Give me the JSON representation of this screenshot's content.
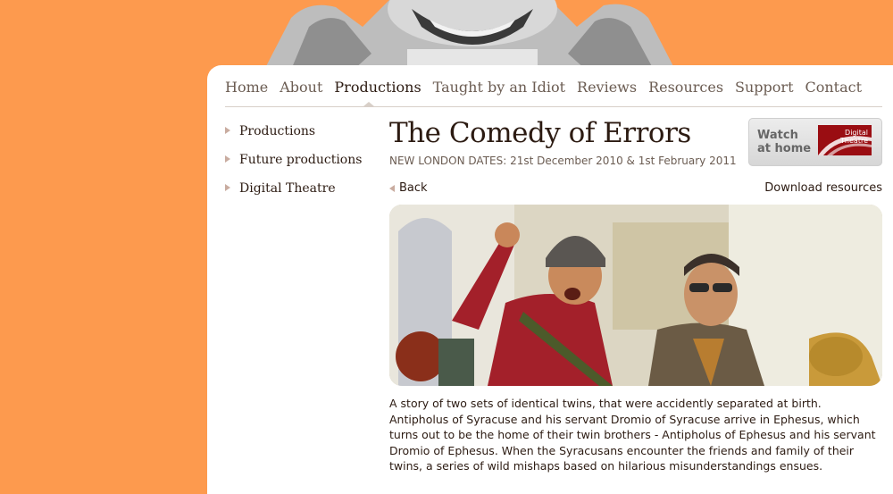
{
  "nav": {
    "items": [
      "Home",
      "About",
      "Productions",
      "Taught by an Idiot",
      "Reviews",
      "Resources",
      "Support",
      "Contact"
    ],
    "active": "Productions"
  },
  "sidebar": {
    "items": [
      "Productions",
      "Future productions",
      "Digital Theatre"
    ]
  },
  "page": {
    "title": "The Comedy of Errors",
    "subtitle": "NEW LONDON DATES: 21st December 2010 & 1st February 2011",
    "back_label": "Back",
    "download_label": "Download resources",
    "description": "A story of two sets of identical twins, that were accidently separated at birth. Antipholus of Syracuse and his servant Dromio of Syracuse arrive in Ephesus, which turns out to be the home of their twin brothers - Antipholus of Ephesus and his servant Dromio of Ephesus. When the Syracusans encounter the friends and family of their twins, a series of wild mishaps based on hilarious misunderstandings ensues."
  },
  "watch_badge": {
    "line1": "Watch",
    "line2": "at home",
    "logo_line1": "Digital",
    "logo_line2": "Theatre"
  },
  "colors": {
    "background": "#fd9a4e",
    "panel": "#ffffff",
    "heading": "#2c1b12",
    "nav_text": "#6b5c52",
    "logo_red": "#9a0d12"
  }
}
